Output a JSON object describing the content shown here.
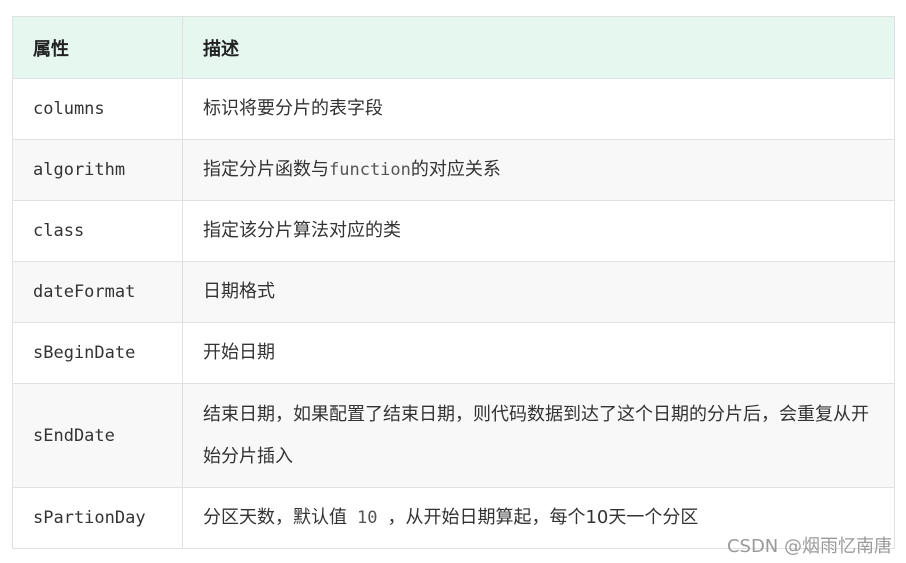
{
  "table": {
    "headers": [
      "属性",
      "描述"
    ],
    "rows": [
      {
        "attr": "columns",
        "desc": "标识将要分片的表字段"
      },
      {
        "attr": "algorithm",
        "desc_pre": "指定分片函数与",
        "desc_code": "function",
        "desc_post": "的对应关系"
      },
      {
        "attr": "class",
        "desc": "指定该分片算法对应的类"
      },
      {
        "attr": "dateFormat",
        "desc": "日期格式"
      },
      {
        "attr": "sBeginDate",
        "desc": "开始日期"
      },
      {
        "attr": "sEndDate",
        "desc": "结束日期，如果配置了结束日期，则代码数据到达了这个日期的分片后，会重复从开始分片插入"
      },
      {
        "attr": "sPartionDay",
        "desc_pre": "分区天数，默认值",
        "desc_code": "10",
        "desc_post": "，从开始日期算起，每个",
        "desc_code2": "10",
        "desc_post2": "天一个分区"
      }
    ]
  },
  "watermark": "CSDN @烟雨忆南唐"
}
